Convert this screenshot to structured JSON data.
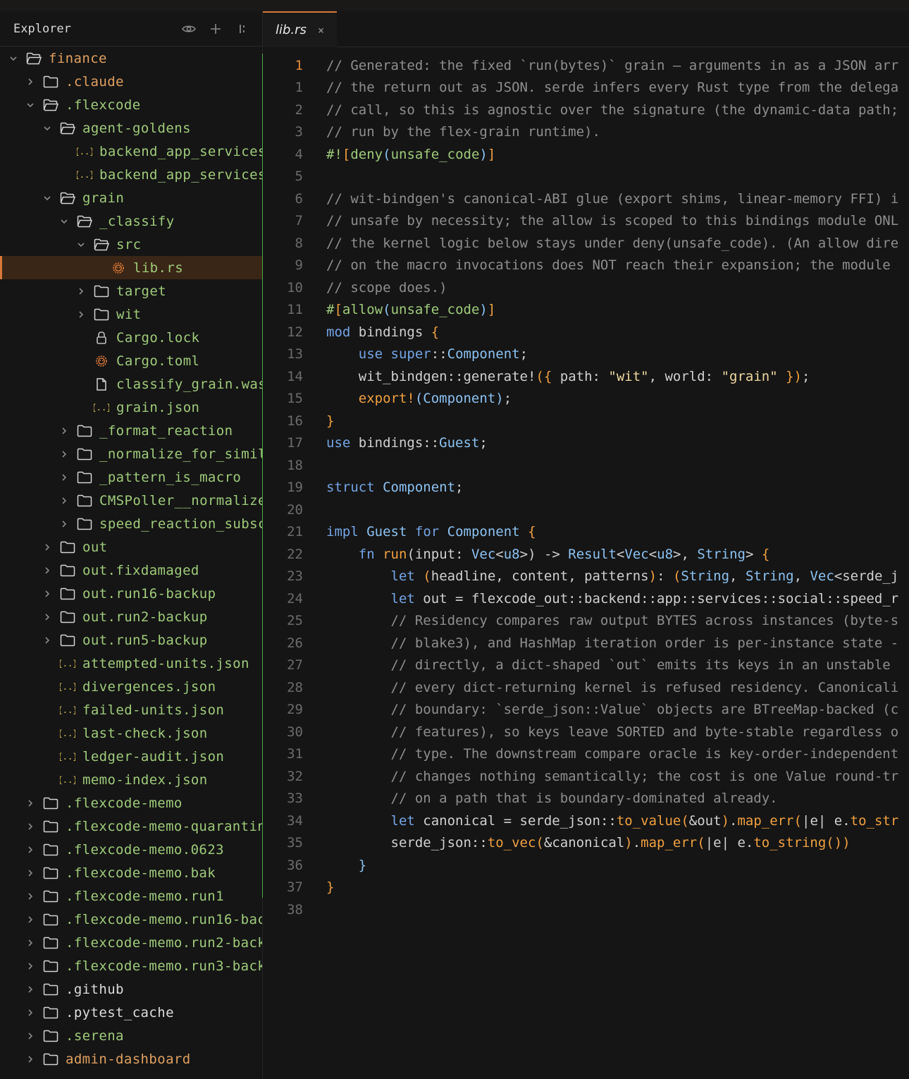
{
  "explorer": {
    "title": "Explorer",
    "tree": [
      {
        "depth": 0,
        "type": "folder",
        "open": true,
        "label": "finance",
        "color": "orange"
      },
      {
        "depth": 1,
        "type": "folder",
        "open": false,
        "label": ".claude",
        "color": "orange"
      },
      {
        "depth": 1,
        "type": "folder",
        "open": true,
        "label": ".flexcode",
        "color": "green"
      },
      {
        "depth": 2,
        "type": "folder",
        "open": true,
        "label": "agent-goldens",
        "color": "green"
      },
      {
        "depth": 3,
        "type": "json",
        "label": "backend_app_services",
        "color": "green"
      },
      {
        "depth": 3,
        "type": "json",
        "label": "backend_app_services",
        "color": "green"
      },
      {
        "depth": 2,
        "type": "folder",
        "open": true,
        "label": "grain",
        "color": "green"
      },
      {
        "depth": 3,
        "type": "folder",
        "open": true,
        "label": "_classify",
        "color": "green"
      },
      {
        "depth": 4,
        "type": "folder",
        "open": true,
        "label": "src",
        "color": "green"
      },
      {
        "depth": 5,
        "type": "rust",
        "label": "lib.rs",
        "color": "green",
        "selected": true
      },
      {
        "depth": 4,
        "type": "folder",
        "open": false,
        "label": "target",
        "color": "green"
      },
      {
        "depth": 4,
        "type": "folder",
        "open": false,
        "label": "wit",
        "color": "green"
      },
      {
        "depth": 4,
        "type": "lock",
        "label": "Cargo.lock",
        "color": "green"
      },
      {
        "depth": 4,
        "type": "rust",
        "label": "Cargo.toml",
        "color": "green"
      },
      {
        "depth": 4,
        "type": "file",
        "label": "classify_grain.was",
        "color": "green"
      },
      {
        "depth": 4,
        "type": "json",
        "label": "grain.json",
        "color": "green"
      },
      {
        "depth": 3,
        "type": "folder",
        "open": false,
        "label": "_format_reaction",
        "color": "green"
      },
      {
        "depth": 3,
        "type": "folder",
        "open": false,
        "label": "_normalize_for_simil",
        "color": "green"
      },
      {
        "depth": 3,
        "type": "folder",
        "open": false,
        "label": "_pattern_is_macro",
        "color": "green"
      },
      {
        "depth": 3,
        "type": "folder",
        "open": false,
        "label": "CMSPoller__normalize",
        "color": "green"
      },
      {
        "depth": 3,
        "type": "folder",
        "open": false,
        "label": "speed_reaction_subsc",
        "color": "green"
      },
      {
        "depth": 2,
        "type": "folder",
        "open": false,
        "label": "out",
        "color": "green"
      },
      {
        "depth": 2,
        "type": "folder",
        "open": false,
        "label": "out.fixdamaged",
        "color": "green"
      },
      {
        "depth": 2,
        "type": "folder",
        "open": false,
        "label": "out.run16-backup",
        "color": "green"
      },
      {
        "depth": 2,
        "type": "folder",
        "open": false,
        "label": "out.run2-backup",
        "color": "green"
      },
      {
        "depth": 2,
        "type": "folder",
        "open": false,
        "label": "out.run5-backup",
        "color": "green"
      },
      {
        "depth": 2,
        "type": "json",
        "label": "attempted-units.json",
        "color": "green"
      },
      {
        "depth": 2,
        "type": "json",
        "label": "divergences.json",
        "color": "green"
      },
      {
        "depth": 2,
        "type": "json",
        "label": "failed-units.json",
        "color": "green"
      },
      {
        "depth": 2,
        "type": "json",
        "label": "last-check.json",
        "color": "green"
      },
      {
        "depth": 2,
        "type": "json",
        "label": "ledger-audit.json",
        "color": "green"
      },
      {
        "depth": 2,
        "type": "json",
        "label": "memo-index.json",
        "color": "green"
      },
      {
        "depth": 1,
        "type": "folder",
        "open": false,
        "label": ".flexcode-memo",
        "color": "green"
      },
      {
        "depth": 1,
        "type": "folder",
        "open": false,
        "label": ".flexcode-memo-quarantin",
        "color": "green"
      },
      {
        "depth": 1,
        "type": "folder",
        "open": false,
        "label": ".flexcode-memo.0623",
        "color": "green"
      },
      {
        "depth": 1,
        "type": "folder",
        "open": false,
        "label": ".flexcode-memo.bak",
        "color": "green"
      },
      {
        "depth": 1,
        "type": "folder",
        "open": false,
        "label": ".flexcode-memo.run1",
        "color": "green"
      },
      {
        "depth": 1,
        "type": "folder",
        "open": false,
        "label": ".flexcode-memo.run16-bac",
        "color": "green"
      },
      {
        "depth": 1,
        "type": "folder",
        "open": false,
        "label": ".flexcode-memo.run2-back",
        "color": "green"
      },
      {
        "depth": 1,
        "type": "folder",
        "open": false,
        "label": ".flexcode-memo.run3-back",
        "color": "green"
      },
      {
        "depth": 1,
        "type": "folder",
        "open": false,
        "label": ".github",
        "color": "white"
      },
      {
        "depth": 1,
        "type": "folder",
        "open": false,
        "label": ".pytest_cache",
        "color": "white"
      },
      {
        "depth": 1,
        "type": "folder",
        "open": false,
        "label": ".serena",
        "color": "green"
      },
      {
        "depth": 1,
        "type": "folder",
        "open": false,
        "label": "admin-dashboard",
        "color": "orange"
      }
    ]
  },
  "tab": {
    "label": "lib.rs",
    "close": "×"
  },
  "editor": {
    "lines": [
      {
        "n": "1",
        "cur": true,
        "t": [
          [
            "cm",
            "// Generated: the fixed `run(bytes)` grain — arguments in as a JSON arr"
          ]
        ]
      },
      {
        "n": "1",
        "t": [
          [
            "cm",
            "// the return out as JSON. serde infers every Rust type from the delega"
          ]
        ]
      },
      {
        "n": "2",
        "t": [
          [
            "cm",
            "// call, so this is agnostic over the signature (the dynamic-data path;"
          ]
        ]
      },
      {
        "n": "3",
        "t": [
          [
            "cm",
            "// run by the flex-grain runtime)."
          ]
        ]
      },
      {
        "n": "4",
        "t": [
          [
            "at",
            "#!"
          ],
          [
            "fn",
            "["
          ],
          [
            "at",
            "deny"
          ],
          [
            "ty",
            "("
          ],
          [
            "at",
            "unsafe_code"
          ],
          [
            "ty",
            ")"
          ],
          [
            "fn",
            "]"
          ]
        ]
      },
      {
        "n": "5",
        "t": []
      },
      {
        "n": "6",
        "t": [
          [
            "cm",
            "// wit-bindgen's canonical-ABI glue (export shims, linear-memory FFI) i"
          ]
        ]
      },
      {
        "n": "7",
        "t": [
          [
            "cm",
            "// unsafe by necessity; the allow is scoped to this bindings module ONL"
          ]
        ]
      },
      {
        "n": "8",
        "t": [
          [
            "cm",
            "// the kernel logic below stays under deny(unsafe_code). (An allow dire"
          ]
        ]
      },
      {
        "n": "9",
        "t": [
          [
            "cm",
            "// on the macro invocations does NOT reach their expansion; the module"
          ]
        ]
      },
      {
        "n": "10",
        "t": [
          [
            "cm",
            "// scope does.)"
          ]
        ]
      },
      {
        "n": "11",
        "t": [
          [
            "at",
            "#"
          ],
          [
            "fn",
            "["
          ],
          [
            "at",
            "allow"
          ],
          [
            "ty",
            "("
          ],
          [
            "at",
            "unsafe_code"
          ],
          [
            "ty",
            ")"
          ],
          [
            "fn",
            "]"
          ]
        ]
      },
      {
        "n": "12",
        "t": [
          [
            "kw",
            "mod"
          ],
          [
            "pu",
            " bindings "
          ],
          [
            "fn",
            "{"
          ]
        ]
      },
      {
        "n": "13",
        "t": [
          [
            "pu",
            "    "
          ],
          [
            "kw",
            "use"
          ],
          [
            "pu",
            " "
          ],
          [
            "kw",
            "super"
          ],
          [
            "pu",
            "::"
          ],
          [
            "ty",
            "Component"
          ],
          [
            "pu",
            ";"
          ]
        ]
      },
      {
        "n": "14",
        "t": [
          [
            "pu",
            "    wit_bindgen::generate!"
          ],
          [
            "fn",
            "("
          ],
          [
            "fn",
            "{"
          ],
          [
            "pu",
            " path: "
          ],
          [
            "st",
            "\"wit\""
          ],
          [
            "pu",
            ", world: "
          ],
          [
            "st",
            "\"grain\""
          ],
          [
            "pu",
            " "
          ],
          [
            "fn",
            "}"
          ],
          [
            "fn",
            ")"
          ],
          [
            "pu",
            ";"
          ]
        ]
      },
      {
        "n": "15",
        "t": [
          [
            "pu",
            "    "
          ],
          [
            "fn",
            "export!"
          ],
          [
            "ty",
            "("
          ],
          [
            "ty",
            "Component"
          ],
          [
            "ty",
            ")"
          ],
          [
            "pu",
            ";"
          ]
        ]
      },
      {
        "n": "16",
        "t": [
          [
            "fn",
            "}"
          ]
        ]
      },
      {
        "n": "17",
        "t": [
          [
            "kw",
            "use"
          ],
          [
            "pu",
            " bindings::"
          ],
          [
            "ty",
            "Guest"
          ],
          [
            "pu",
            ";"
          ]
        ]
      },
      {
        "n": "18",
        "t": []
      },
      {
        "n": "19",
        "t": [
          [
            "kw",
            "struct"
          ],
          [
            "pu",
            " "
          ],
          [
            "ty",
            "Component"
          ],
          [
            "pu",
            ";"
          ]
        ]
      },
      {
        "n": "20",
        "t": []
      },
      {
        "n": "21",
        "t": [
          [
            "kw",
            "impl"
          ],
          [
            "pu",
            " "
          ],
          [
            "ty",
            "Guest"
          ],
          [
            "pu",
            " "
          ],
          [
            "kw",
            "for"
          ],
          [
            "pu",
            " "
          ],
          [
            "ty",
            "Component"
          ],
          [
            "pu",
            " "
          ],
          [
            "fn",
            "{"
          ]
        ]
      },
      {
        "n": "22",
        "t": [
          [
            "pu",
            "    "
          ],
          [
            "kw",
            "fn"
          ],
          [
            "pu",
            " "
          ],
          [
            "fn",
            "run"
          ],
          [
            "pu",
            "(input: "
          ],
          [
            "ty",
            "Vec"
          ],
          [
            "pu",
            "<"
          ],
          [
            "ty",
            "u8"
          ],
          [
            "pu",
            ">) -> "
          ],
          [
            "ty",
            "Result"
          ],
          [
            "pu",
            "<"
          ],
          [
            "ty",
            "Vec"
          ],
          [
            "pu",
            "<"
          ],
          [
            "ty",
            "u8"
          ],
          [
            "pu",
            ">, "
          ],
          [
            "ty",
            "String"
          ],
          [
            "pu",
            "> "
          ],
          [
            "fn",
            "{"
          ]
        ]
      },
      {
        "n": "23",
        "t": [
          [
            "pu",
            "        "
          ],
          [
            "kw",
            "let"
          ],
          [
            "pu",
            " "
          ],
          [
            "fn",
            "("
          ],
          [
            "pu",
            "headline, content, patterns"
          ],
          [
            "fn",
            ")"
          ],
          [
            "pu",
            ": "
          ],
          [
            "fn",
            "("
          ],
          [
            "ty",
            "String"
          ],
          [
            "pu",
            ", "
          ],
          [
            "ty",
            "String"
          ],
          [
            "pu",
            ", "
          ],
          [
            "ty",
            "Vec"
          ],
          [
            "pu",
            "<serde_j"
          ]
        ]
      },
      {
        "n": "24",
        "t": [
          [
            "pu",
            "        "
          ],
          [
            "kw",
            "let"
          ],
          [
            "pu",
            " out = flexcode_out::backend::app::services::social::speed_r"
          ]
        ]
      },
      {
        "n": "25",
        "t": [
          [
            "pu",
            "        "
          ],
          [
            "cm",
            "// Residency compares raw output BYTES across instances (byte-s"
          ]
        ]
      },
      {
        "n": "26",
        "t": [
          [
            "pu",
            "        "
          ],
          [
            "cm",
            "// blake3), and HashMap iteration order is per-instance state -"
          ]
        ]
      },
      {
        "n": "27",
        "t": [
          [
            "pu",
            "        "
          ],
          [
            "cm",
            "// directly, a dict-shaped `out` emits its keys in an unstable"
          ]
        ]
      },
      {
        "n": "28",
        "t": [
          [
            "pu",
            "        "
          ],
          [
            "cm",
            "// every dict-returning kernel is refused residency. Canonicali"
          ]
        ]
      },
      {
        "n": "29",
        "t": [
          [
            "pu",
            "        "
          ],
          [
            "cm",
            "// boundary: `serde_json::Value` objects are BTreeMap-backed (c"
          ]
        ]
      },
      {
        "n": "30",
        "t": [
          [
            "pu",
            "        "
          ],
          [
            "cm",
            "// features), so keys leave SORTED and byte-stable regardless o"
          ]
        ]
      },
      {
        "n": "31",
        "t": [
          [
            "pu",
            "        "
          ],
          [
            "cm",
            "// type. The downstream compare oracle is key-order-independent"
          ]
        ]
      },
      {
        "n": "32",
        "t": [
          [
            "pu",
            "        "
          ],
          [
            "cm",
            "// changes nothing semantically; the cost is one Value round-tr"
          ]
        ]
      },
      {
        "n": "33",
        "t": [
          [
            "pu",
            "        "
          ],
          [
            "cm",
            "// on a path that is boundary-dominated already."
          ]
        ]
      },
      {
        "n": "34",
        "t": [
          [
            "pu",
            "        "
          ],
          [
            "kw",
            "let"
          ],
          [
            "pu",
            " canonical = serde_json::"
          ],
          [
            "fn",
            "to_value"
          ],
          [
            "fn",
            "("
          ],
          [
            "pu",
            "&out"
          ],
          [
            "fn",
            ")"
          ],
          [
            "pu",
            "."
          ],
          [
            "fn",
            "map_err"
          ],
          [
            "fn",
            "("
          ],
          [
            "pu",
            "|e| e."
          ],
          [
            "fn",
            "to_str"
          ]
        ]
      },
      {
        "n": "35",
        "t": [
          [
            "pu",
            "        serde_json::"
          ],
          [
            "fn",
            "to_vec"
          ],
          [
            "fn",
            "("
          ],
          [
            "pu",
            "&canonical"
          ],
          [
            "fn",
            ")"
          ],
          [
            "pu",
            "."
          ],
          [
            "fn",
            "map_err"
          ],
          [
            "fn",
            "("
          ],
          [
            "pu",
            "|e| e."
          ],
          [
            "fn",
            "to_string"
          ],
          [
            "fn",
            "()"
          ],
          [
            "fn",
            ")"
          ]
        ]
      },
      {
        "n": "36",
        "t": [
          [
            "pu",
            "    "
          ],
          [
            "ty",
            "}"
          ]
        ]
      },
      {
        "n": "37",
        "t": [
          [
            "fn",
            "}"
          ]
        ]
      },
      {
        "n": "38",
        "t": []
      }
    ]
  }
}
